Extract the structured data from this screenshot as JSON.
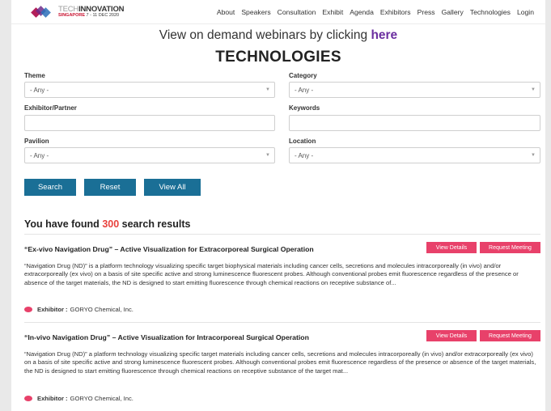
{
  "logo": {
    "tech": "TECH",
    "innovation": "INNOVATION",
    "location": "SINGAPORE",
    "dates": "7 - 11 DEC 2020"
  },
  "nav": [
    "About",
    "Speakers",
    "Consultation",
    "Exhibit",
    "Agenda",
    "Exhibitors",
    "Press",
    "Gallery",
    "Technologies",
    "Login"
  ],
  "banner": {
    "text": "View on demand webinars by clicking",
    "link": "here"
  },
  "page_title": "TECHNOLOGIES",
  "filters": {
    "theme": {
      "label": "Theme",
      "value": "- Any -"
    },
    "category": {
      "label": "Category",
      "value": "- Any -"
    },
    "exhibitor": {
      "label": "Exhibitor/Partner",
      "value": ""
    },
    "keywords": {
      "label": "Keywords",
      "value": ""
    },
    "pavilion": {
      "label": "Pavilion",
      "value": "- Any -"
    },
    "location": {
      "label": "Location",
      "value": "- Any -"
    }
  },
  "buttons": {
    "search": "Search",
    "reset": "Reset",
    "view_all": "View All"
  },
  "results": {
    "prefix": "You have found",
    "count": "300",
    "suffix": "search results"
  },
  "item_buttons": {
    "details": "View Details",
    "meeting": "Request Meeting"
  },
  "items": [
    {
      "title": "“Ex-vivo Navigation Drug” – Active Visualization for Extracorporeal Surgical Operation",
      "desc": "“Navigation Drug (ND)” is a platform technology visualizing specific target biophysical materials including cancer cells, secretions and molecules intracorporeally (in vivo) and/or extracorporeally (ex vivo) on a basis of site specific active and strong luminescence fluorescent probes. Although conventional probes emit fluorescence regardless of the presence or absence of the target materials, the ND is designed to start emitting fluorescence through chemical reactions on receptive substance of...",
      "exhibitor_label": "Exhibitor :",
      "exhibitor": "GORYO Chemical, Inc."
    },
    {
      "title": "“In-vivo Navigation Drug” – Active Visualization for Intracorporeal Surgical Operation",
      "desc": "“Navigation Drug (ND)” a platform technology visualizing specific target materials including cancer cells, secretions and molecules intracorporeally (in vivo) and/or extracorporeally (ex vivo) on a basis of site specific active and strong luminescence fluorescent probes. Although conventional probes emit fluorescence regardless of the presence or absence of the target materials, the ND is designed to start emitting fluorescence through chemical reactions on receptive substance of the target mat...",
      "exhibitor_label": "Exhibitor :",
      "exhibitor": "GORYO Chemical, Inc."
    }
  ]
}
